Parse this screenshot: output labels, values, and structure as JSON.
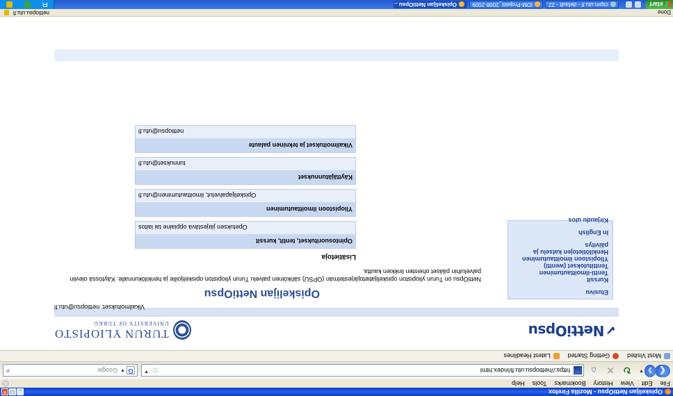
{
  "browser": {
    "window_title": "Opiskelijan NettiOpsu - Mozilla Firefox",
    "menu": [
      "File",
      "Edit",
      "View",
      "History",
      "Bookmarks",
      "Tools",
      "Help"
    ],
    "url": "https://nettiopsu.utu.fi/index.html",
    "search_placeholder": "Google",
    "bookmarks": [
      "Most Visited",
      "Getting Started",
      "Latest Headlines"
    ],
    "status_text": "Done",
    "status_domain": "nettiopsu.utu.fi"
  },
  "page": {
    "logo_nettiopsu": "NettiOpsu",
    "uni_name": "TURUN YLIOPISTO",
    "uni_name_en": "UNIVERSITY OF TURKU",
    "nav": {
      "etusivu": "Etusivu",
      "kurssit": "Kurssit",
      "tentti_ilmo": "Tentti-ilmoittautuminen",
      "tenttitulokset": "Tenttitulokset (wentti)",
      "yliopisto_ilmo": "Yliopistoon ilmoittautuminen",
      "henkilotiedot": "Henkilötietojen katselu ja päivitys",
      "english": "In English",
      "kirjaudu": "Kirjaudu ulos"
    },
    "title": "Opiskelijan NettiOpsu",
    "intro": "NettiOpsu on Turun yliopiston opiskelijatietojärjestelmän (OPSU) sähköinen palvelu Turun yliopiston opiskelijoille ja henkilökunnalle. Käytössä oleviin palveluihin pääset oheisten linkkien kautta.",
    "more_info_heading": "Lisätietoja",
    "info_boxes": [
      {
        "heading": "Opintosuoritukset, tentit, kurssit",
        "body": "Opetuksen järjestävä oppiaine tai laitos"
      },
      {
        "heading": "Yliopistoon ilmoittautuminen",
        "body": "Opiskelijapalvelut, ilmoittautuminen@utu.fi"
      },
      {
        "heading": "Käyttäjätunnukset",
        "body": "tunnukset@utu.fi"
      },
      {
        "heading": "Vikailmoitukset ja tekninen palaute",
        "body": "nettiopsu@utu.fi"
      }
    ],
    "contact": "Vikailmoitukset: nettiopsu@utu.fi"
  },
  "taskbar": {
    "start": "start",
    "tasks": [
      {
        "label": "cspm.utu.fi - default - 22...",
        "active": false
      },
      {
        "label": "IDM-Projekti_2008-2009 ...",
        "active": false
      },
      {
        "label": "Opiskelijan NettiOpsu ...",
        "active": true
      }
    ],
    "tray_lang": "FI"
  }
}
